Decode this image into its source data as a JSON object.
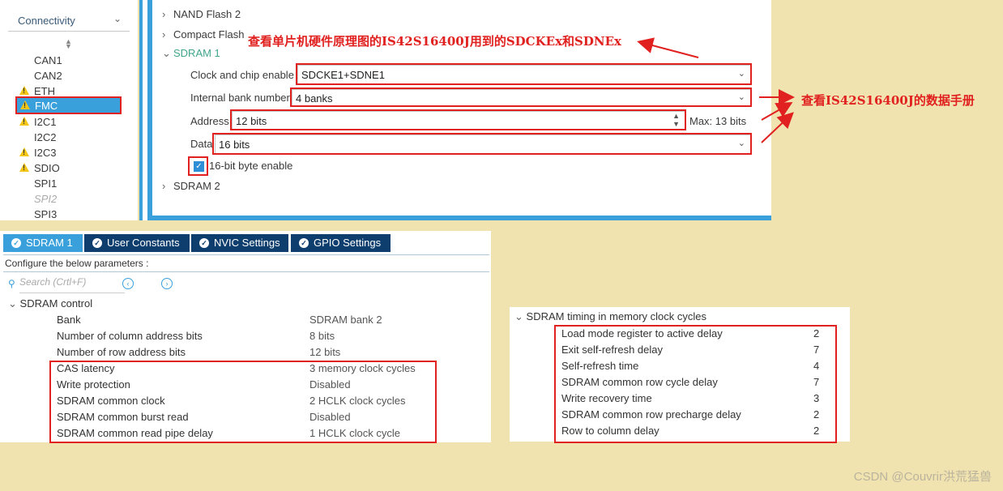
{
  "sidebar": {
    "category": "Connectivity",
    "items": [
      {
        "label": "CAN1",
        "warn": false
      },
      {
        "label": "CAN2",
        "warn": false
      },
      {
        "label": "ETH",
        "warn": true
      },
      {
        "label": "FMC",
        "warn": true
      },
      {
        "label": "I2C1",
        "warn": true
      },
      {
        "label": "I2C2",
        "warn": false
      },
      {
        "label": "I2C3",
        "warn": true
      },
      {
        "label": "SDIO",
        "warn": true
      },
      {
        "label": "SPI1",
        "warn": false
      },
      {
        "label": "SPI2",
        "warn": false
      },
      {
        "label": "SPI3",
        "warn": false
      }
    ]
  },
  "fmc": {
    "nand_flash": "NAND Flash 2",
    "compact_flash": "Compact Flash",
    "sdram1": "SDRAM 1",
    "sdram2": "SDRAM 2",
    "fields": {
      "clock_label": "Clock and chip enable",
      "clock_value": "SDCKE1+SDNE1",
      "bank_label": "Internal bank number",
      "bank_value": "4 banks",
      "address_label": "Address",
      "address_value": "12 bits",
      "address_max": "Max: 13 bits",
      "data_label": "Data",
      "data_value": "16 bits",
      "byte_enable_label": "16-bit byte enable"
    }
  },
  "annotations": {
    "top": "查看单片机硬件原理图的IS42S16400J用到的SDCKEx和SDNEx",
    "right": "查看IS42S16400J的数据手册"
  },
  "params": {
    "tabs": [
      "SDRAM 1",
      "User Constants",
      "NVIC Settings",
      "GPIO Settings"
    ],
    "configure": "Configure the below parameters :",
    "search_placeholder": "Search (Crtl+F)",
    "group": "SDRAM control",
    "rows": [
      {
        "name": "Bank",
        "value": "SDRAM bank 2"
      },
      {
        "name": "Number of column address bits",
        "value": "8 bits"
      },
      {
        "name": "Number of row address bits",
        "value": "12 bits"
      },
      {
        "name": "CAS latency",
        "value": "3 memory clock cycles"
      },
      {
        "name": "Write protection",
        "value": "Disabled"
      },
      {
        "name": "SDRAM common clock",
        "value": "2 HCLK clock cycles"
      },
      {
        "name": "SDRAM common burst read",
        "value": "Disabled"
      },
      {
        "name": "SDRAM common read pipe delay",
        "value": "1 HCLK clock cycle"
      }
    ]
  },
  "timing": {
    "group": "SDRAM timing in memory clock cycles",
    "rows": [
      {
        "name": "Load mode register to active delay",
        "value": "2"
      },
      {
        "name": "Exit self-refresh delay",
        "value": "7"
      },
      {
        "name": "Self-refresh time",
        "value": "4"
      },
      {
        "name": "SDRAM common row cycle delay",
        "value": "7"
      },
      {
        "name": "Write recovery time",
        "value": "3"
      },
      {
        "name": "SDRAM common row precharge delay",
        "value": "2"
      },
      {
        "name": "Row to column delay",
        "value": "2"
      }
    ]
  },
  "watermark": "CSDN @Couvrir洪荒猛兽",
  "colors": {
    "accent": "#3aa0dc",
    "annotation": "#e0211f",
    "tab_bg": "#0e3e6e",
    "background": "#f1e3b0"
  }
}
